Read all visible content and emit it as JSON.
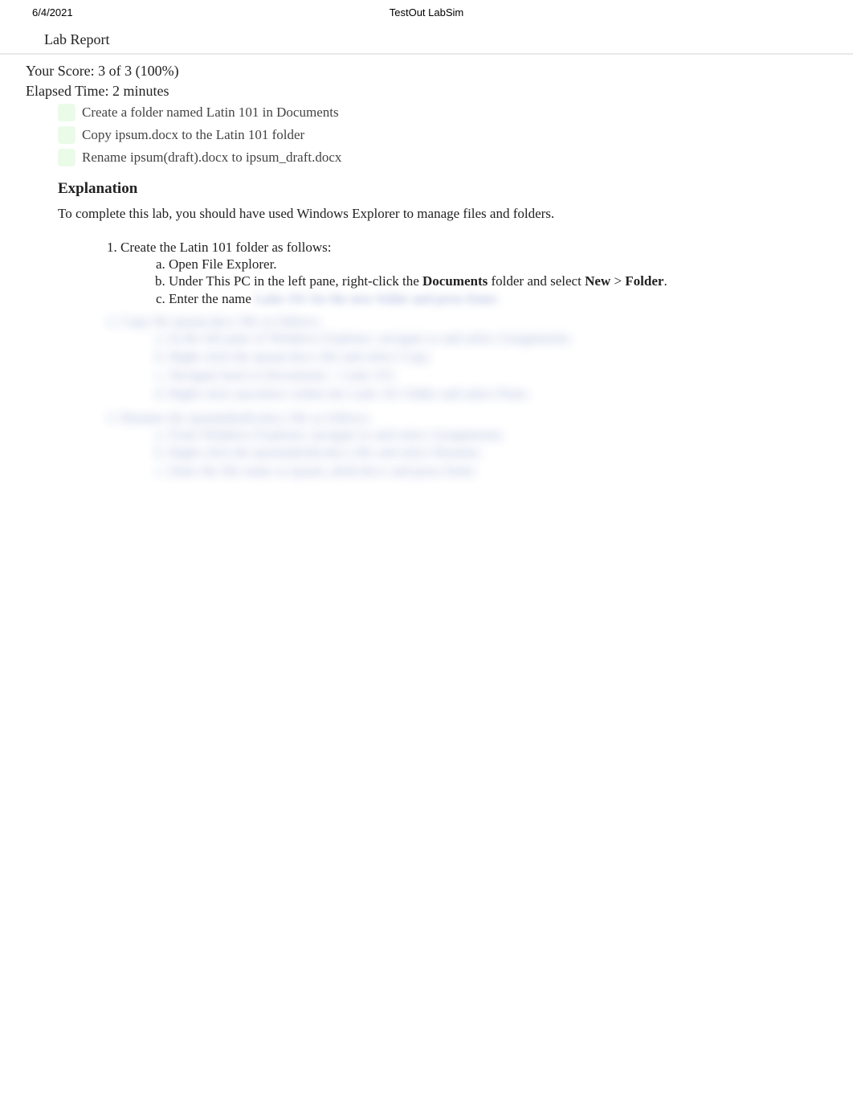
{
  "header": {
    "date": "6/4/2021",
    "title": "TestOut LabSim"
  },
  "report": {
    "title": "Lab Report",
    "score_line": "Your Score: 3 of 3 (100%)",
    "elapsed_line": "Elapsed Time: 2 minutes"
  },
  "tasks": [
    "Create a folder named Latin 101 in Documents",
    "Copy ipsum.docx to the Latin 101 folder",
    "Rename ipsum(draft).docx to ipsum_draft.docx"
  ],
  "explanation": {
    "heading": "Explanation",
    "intro": "To complete this lab, you should have used Windows Explorer to manage files and folders.",
    "step1_title": "Create the Latin 101 folder as follows:",
    "step1_a": "Open File Explorer.",
    "step1_b_prefix": "Under This PC in the left pane, right-click the ",
    "step1_b_bold1": "Documents",
    "step1_b_mid": " folder and select ",
    "step1_b_bold2": "New",
    "step1_b_gt": " > ",
    "step1_b_bold3": "Folder",
    "step1_b_suffix": ".",
    "step1_c": "Enter the name",
    "step1_c_blur": " Latin 101 for the new folder and press Enter."
  }
}
